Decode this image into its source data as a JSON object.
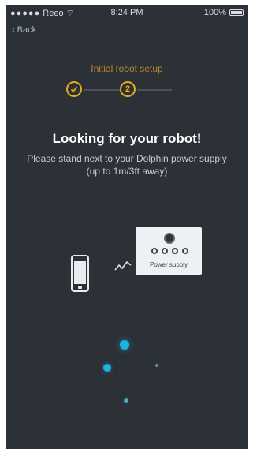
{
  "status_bar": {
    "carrier": "Reeo",
    "time": "8:24 PM",
    "battery": "100%"
  },
  "nav": {
    "back_label": "Back"
  },
  "setup": {
    "title": "Initial robot setup",
    "step2_label": "2"
  },
  "main": {
    "heading": "Looking for your robot!",
    "subtext": "Please stand next to your Dolphin power supply (up to 1m/3ft away)"
  },
  "illustration": {
    "power_supply_label": "Power supply"
  },
  "colors": {
    "background": "#2b3136",
    "accent": "#e7a91d",
    "dot": "#1fb2e0"
  }
}
